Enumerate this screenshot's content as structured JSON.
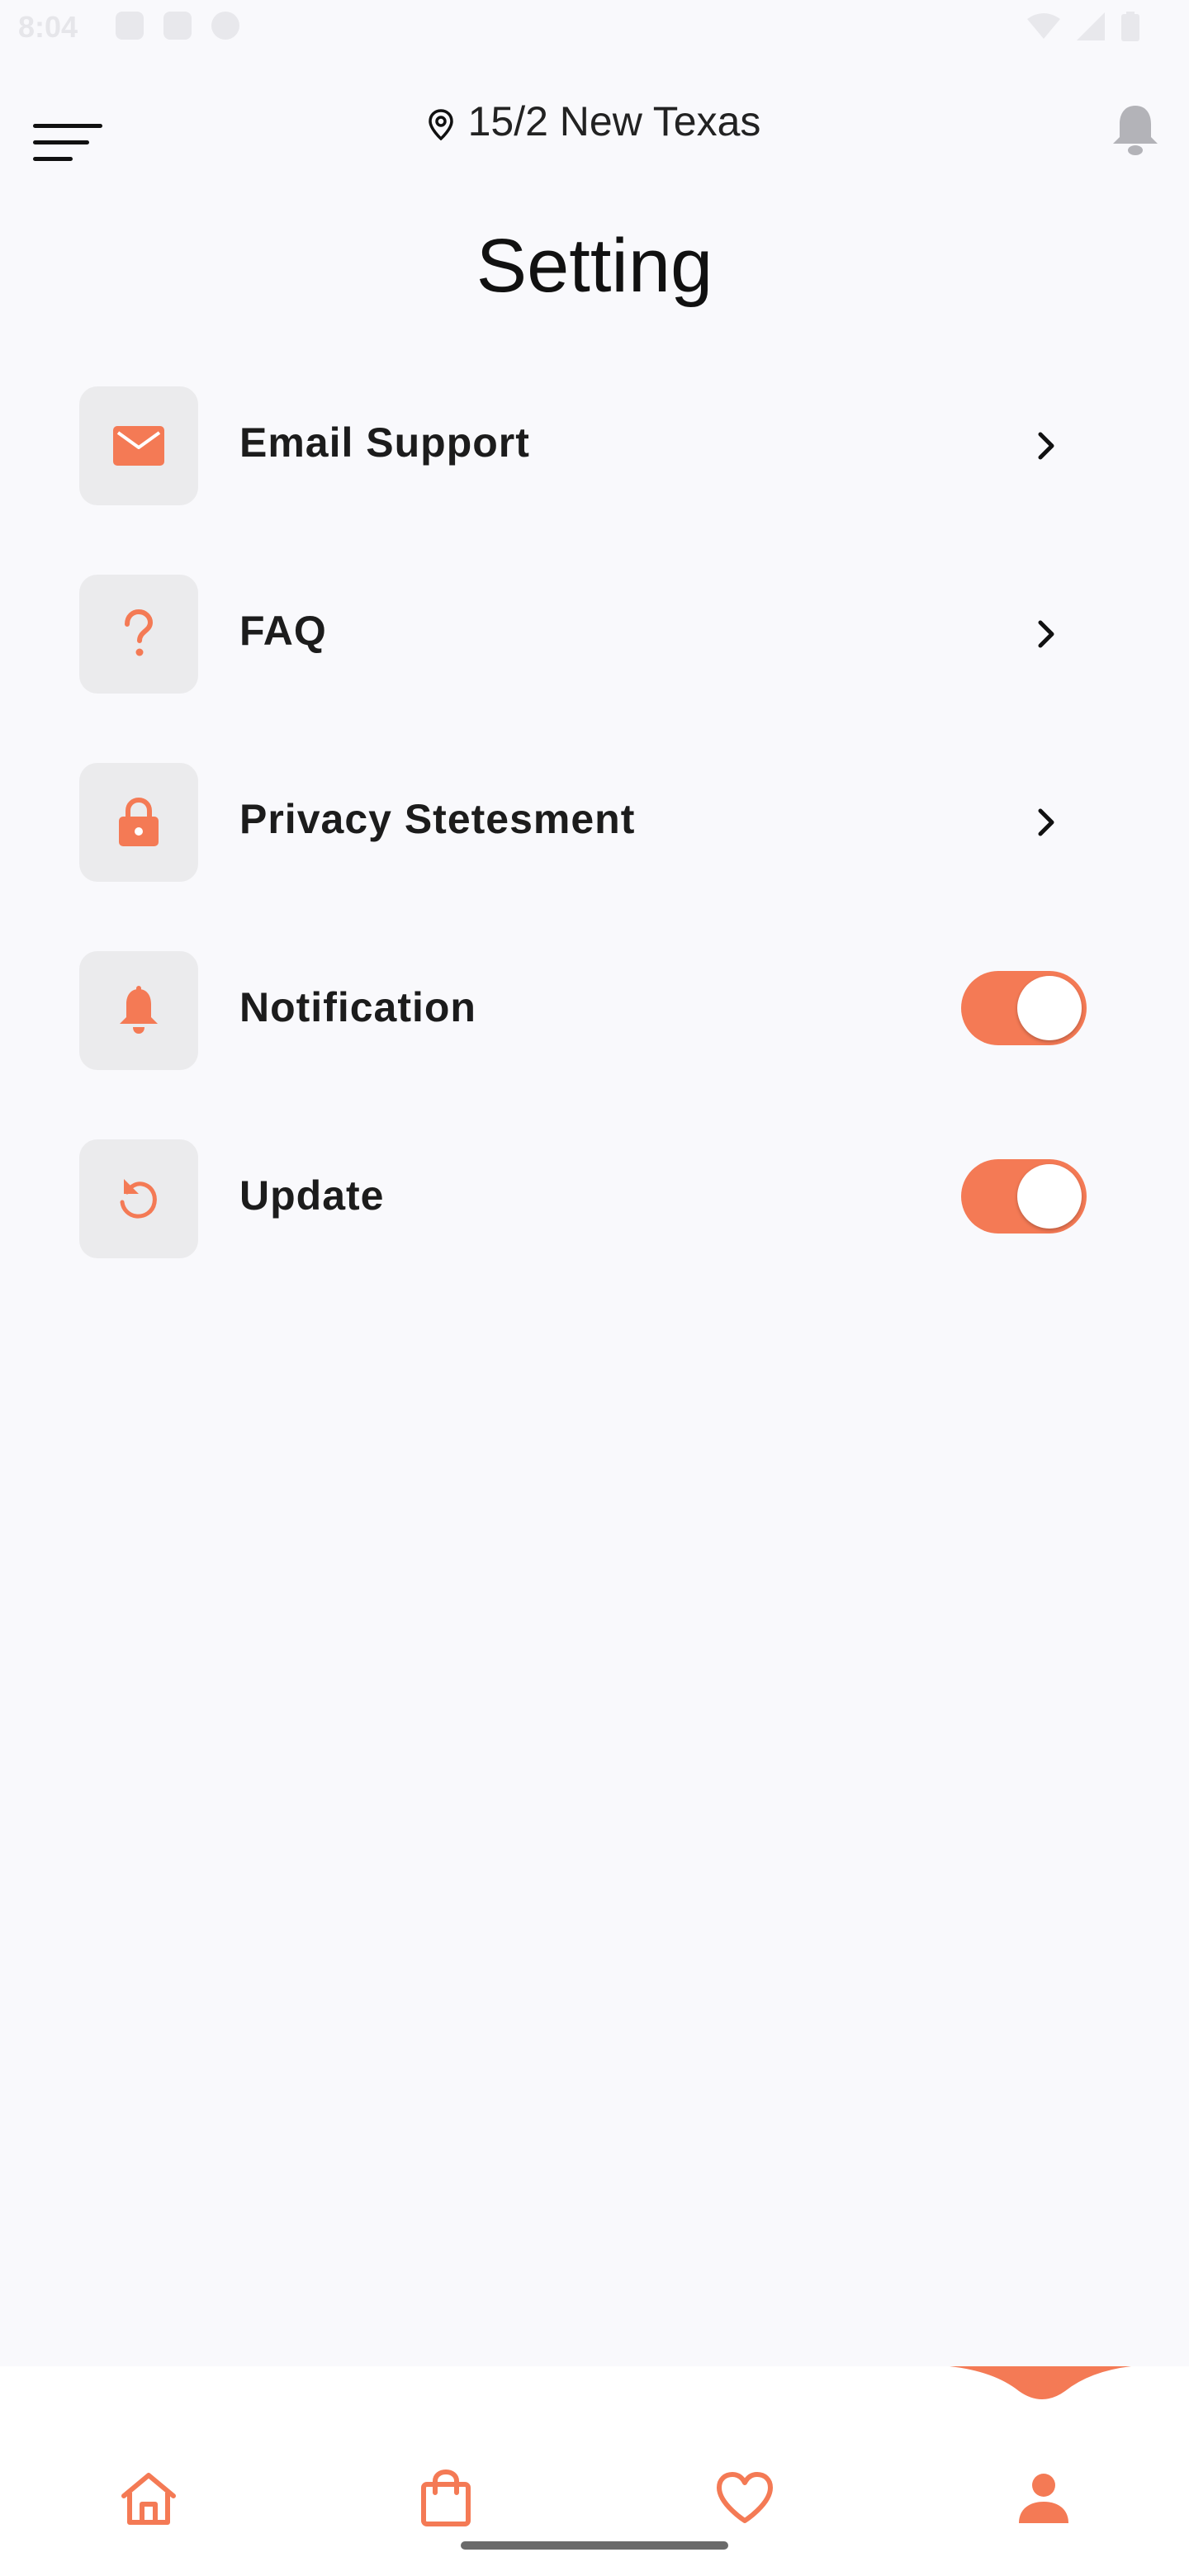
{
  "status_bar": {
    "time": "8:04"
  },
  "header": {
    "location": "15/2 New Texas"
  },
  "page": {
    "title": "Setting"
  },
  "settings": [
    {
      "label": "Email Support",
      "icon": "mail-icon",
      "control": "chevron"
    },
    {
      "label": "FAQ",
      "icon": "question-icon",
      "control": "chevron"
    },
    {
      "label": "Privacy Stetesment",
      "icon": "lock-icon",
      "control": "chevron"
    },
    {
      "label": "Notification",
      "icon": "bell-icon",
      "control": "toggle",
      "value": true
    },
    {
      "label": "Update",
      "icon": "refresh-icon",
      "control": "toggle",
      "value": true
    }
  ],
  "bottom_nav": [
    {
      "icon": "home-icon",
      "active": false
    },
    {
      "icon": "shopping-bag-icon",
      "active": false
    },
    {
      "icon": "heart-icon",
      "active": false
    },
    {
      "icon": "profile-icon",
      "active": true
    }
  ],
  "colors": {
    "accent": "#f47a55",
    "background": "#f9f9fc",
    "icon_box": "#ebebed"
  }
}
